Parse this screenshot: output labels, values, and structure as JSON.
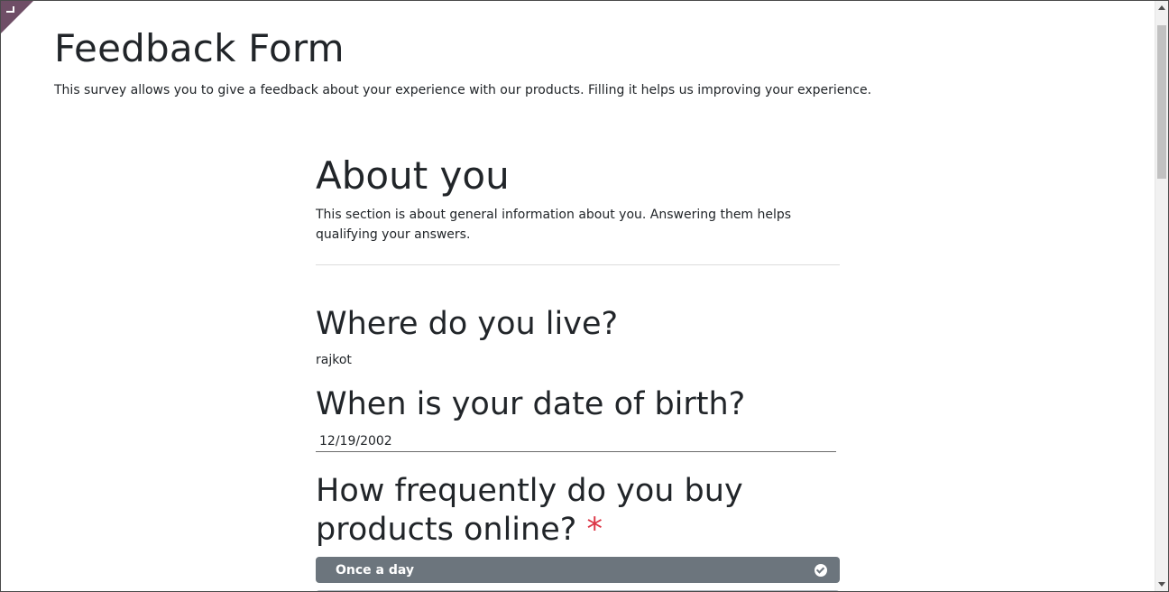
{
  "survey": {
    "title": "Feedback Form",
    "description": "This survey allows you to give a feedback about your experience with our products. Filling it helps us improving your experience."
  },
  "section": {
    "title": "About you",
    "description": "This section is about general information about you. Answering them helps qualifying your answers."
  },
  "questions": [
    {
      "title": "Where do you live?",
      "answer": "rajkot"
    },
    {
      "title": "When is your date of birth?",
      "answer": "12/19/2002"
    },
    {
      "title": "How frequently do you buy products online?",
      "required_mark": "*",
      "choices": [
        {
          "label": "Once a day",
          "selected": true
        }
      ]
    }
  ],
  "colors": {
    "accent": "#6f4e66",
    "choice_selected_bg": "#6c757d",
    "required": "#dc3545"
  }
}
